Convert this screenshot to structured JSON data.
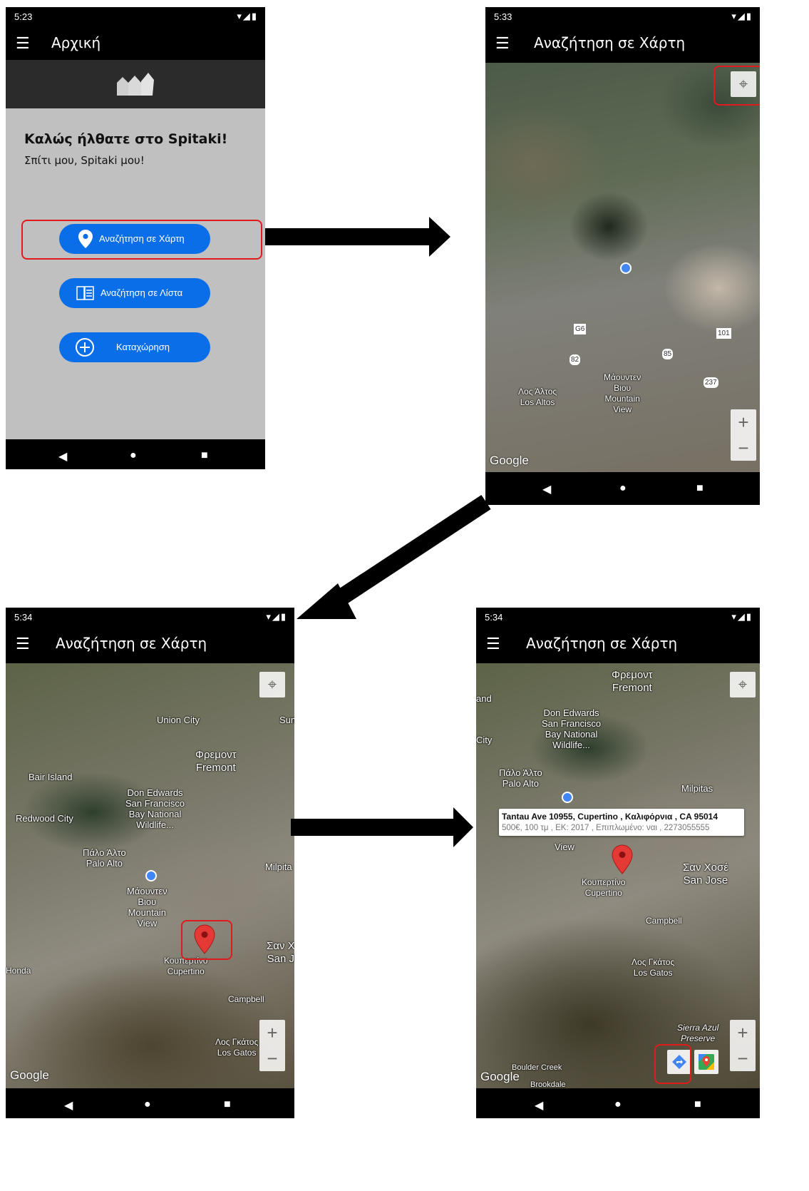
{
  "status": {
    "p1_time": "5:23",
    "p2_time": "5:33",
    "p3_time": "5:34",
    "p4_time": "5:34",
    "icons": "▾◢▮"
  },
  "home": {
    "title": "Αρχική",
    "welcome": "Καλώς ήλθατε στο Spitaki!",
    "subtitle": "Σπίτι μου, Spitaki μου!",
    "btn_map": "Αναζήτηση σε Χάρτη",
    "btn_list": "Αναζήτηση σε Λίστα",
    "btn_add": "Καταχώρηση"
  },
  "map_screen": {
    "title": "Αναζήτηση σε Χάρτη",
    "google": "Google",
    "zoom_in": "+",
    "zoom_out": "−"
  },
  "map2_labels": {
    "los_altos": "Λος Άλτος\nLos Altos",
    "mountain_view": "Μάουντεν\nΒιου\nMountain\nView",
    "g6": "G6",
    "r82": "82",
    "r85": "85",
    "r237": "237",
    "r101": "101"
  },
  "map3_labels": {
    "union_city": "Union City",
    "fremont": "Φρεμοντ\nFremont",
    "bair_island": "Bair Island",
    "redwood_city": "Redwood City",
    "don_edwards": "Don Edwards\nSan Francisco\nBay National\nWildlife...",
    "palo_alto": "Πάλο Άλτο\nPalo Alto",
    "mountain_view": "Μάουντεν\nΒιου\nMountain\nView",
    "cupertino": "Κουπερτίνο\nCupertino",
    "campbell": "Campbell",
    "los_gatos": "Λος Γκάτος\nLos Gatos",
    "san_jose": "Σαν Χ\nSan J",
    "honda": "Honda",
    "milpitas": "Milpita",
    "sun": "Sun"
  },
  "map4_labels": {
    "fremont": "Φρεμοντ\nFremont",
    "don_edwards": "Don Edwards\nSan Francisco\nBay National\nWildlife...",
    "palo_alto": "Πάλο Άλτο\nPalo Alto",
    "milpitas": "Milpitas",
    "view": "View",
    "san_jose": "Σαν Χοσέ\nSan Jose",
    "cupertino": "Κουπερτίνο\nCupertino",
    "campbell": "Campbell",
    "los_gatos": "Λος Γκάτος\nLos Gatos",
    "sierra": "Sierra Azul\nPreserve",
    "boulder": "Boulder Creek",
    "brookdale": "Brookdale",
    "city": "City",
    "and": "and"
  },
  "info_window": {
    "title": "Tantau Ave 10955, Cupertino , Καλιφόρνια , CA 95014",
    "details": "500€, 100 τμ , ΕΚ: 2017 , Επιπλωμένο: ναι , 2273055555"
  },
  "colors": {
    "accent": "#0a6ee8",
    "highlight": "#e01b1b",
    "marker": "#e53935",
    "home_bg": "#c0c0c0"
  }
}
